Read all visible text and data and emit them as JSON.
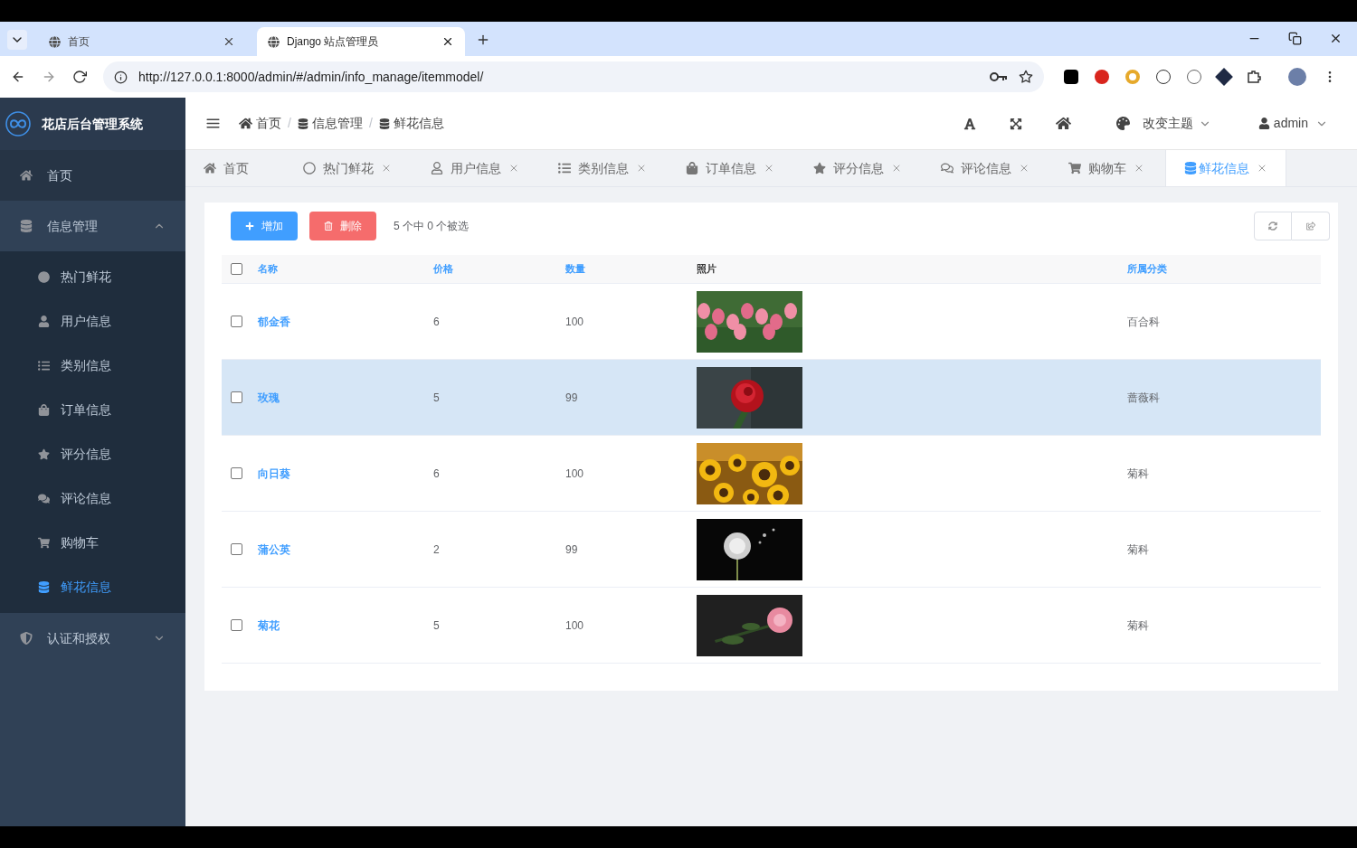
{
  "browser": {
    "tabs": [
      {
        "title": "首页",
        "selected": false
      },
      {
        "title": "Django 站点管理员",
        "selected": true
      }
    ],
    "url": "http://127.0.0.1:8000/admin/#/admin/info_manage/itemmodel/"
  },
  "sidebar": {
    "title": "花店后台管理系统",
    "items": [
      {
        "kind": "link",
        "label": "首页",
        "selected": false
      },
      {
        "kind": "group",
        "label": "信息管理",
        "expanded": true,
        "children": [
          {
            "label": "热门鲜花",
            "selected": false
          },
          {
            "label": "用户信息",
            "selected": false
          },
          {
            "label": "类别信息",
            "selected": false
          },
          {
            "label": "订单信息",
            "selected": false
          },
          {
            "label": "评分信息",
            "selected": false
          },
          {
            "label": "评论信息",
            "selected": false
          },
          {
            "label": "购物车",
            "selected": false
          },
          {
            "label": "鲜花信息",
            "selected": true
          }
        ]
      },
      {
        "kind": "group",
        "label": "认证和授权",
        "expanded": false
      }
    ]
  },
  "header": {
    "breadcrumbs": [
      "首页",
      "信息管理",
      "鲜花信息"
    ],
    "breadcrumb_separator": "/",
    "theme_label": "改变主题",
    "user": "admin"
  },
  "tabs": [
    {
      "label": "首页",
      "closable": false,
      "selected": false
    },
    {
      "label": "热门鲜花",
      "closable": true,
      "selected": false
    },
    {
      "label": "用户信息",
      "closable": true,
      "selected": false
    },
    {
      "label": "类别信息",
      "closable": true,
      "selected": false
    },
    {
      "label": "订单信息",
      "closable": true,
      "selected": false
    },
    {
      "label": "评分信息",
      "closable": true,
      "selected": false
    },
    {
      "label": "评论信息",
      "closable": true,
      "selected": false
    },
    {
      "label": "购物车",
      "closable": true,
      "selected": false
    },
    {
      "label": "鲜花信息",
      "closable": true,
      "selected": true
    }
  ],
  "toolbar": {
    "add": "增加",
    "delete": "删除",
    "selection_count": "5 个中 0 个被选"
  },
  "table": {
    "all_checked": false,
    "columns": [
      {
        "label": "名称",
        "sortable": true
      },
      {
        "label": "价格",
        "sortable": true
      },
      {
        "label": "数量",
        "sortable": true
      },
      {
        "label": "照片",
        "sortable": false
      },
      {
        "label": "所属分类",
        "sortable": true
      }
    ],
    "rows": [
      {
        "name": "郁金香",
        "price": "6",
        "quantity": "100",
        "category": "百合科",
        "checked": false,
        "selected": false
      },
      {
        "name": "玫瑰",
        "price": "5",
        "quantity": "99",
        "category": "蔷薇科",
        "checked": false,
        "selected": true
      },
      {
        "name": "向日葵",
        "price": "6",
        "quantity": "100",
        "category": "菊科",
        "checked": false,
        "selected": false
      },
      {
        "name": "蒲公英",
        "price": "2",
        "quantity": "99",
        "category": "菊科",
        "checked": false,
        "selected": false
      },
      {
        "name": "菊花",
        "price": "5",
        "quantity": "100",
        "category": "菊科",
        "checked": false,
        "selected": false
      }
    ]
  }
}
